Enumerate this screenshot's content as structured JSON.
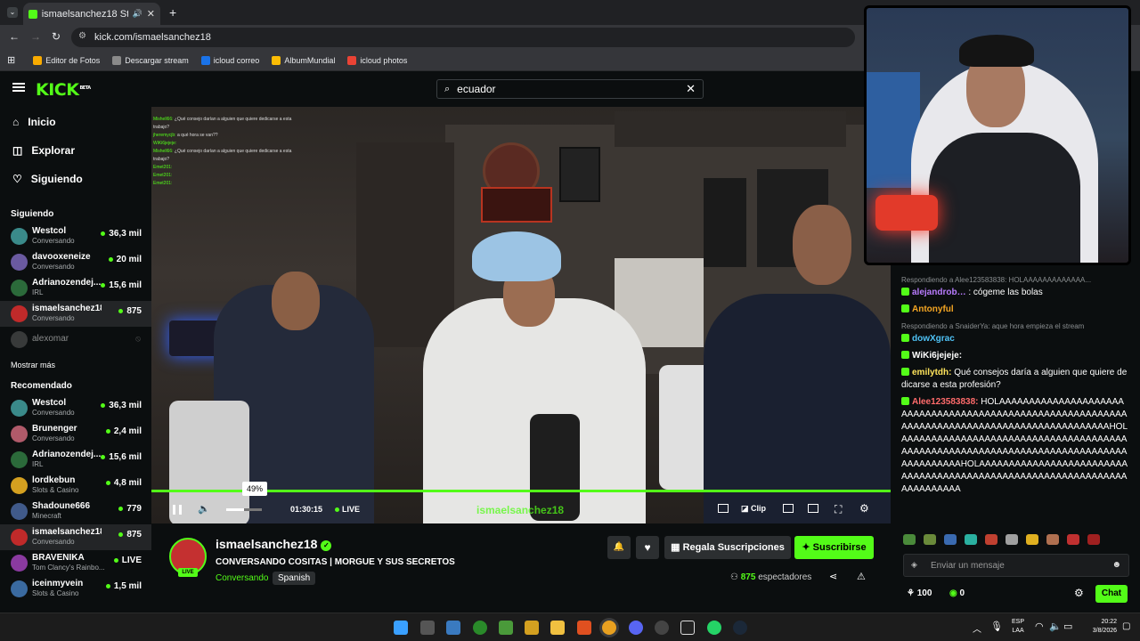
{
  "browser": {
    "tab_title": "ismaelsanchez18 Stream - …",
    "url": "kick.com/ismaelsanchez18",
    "bookmarks": [
      {
        "label": "Editor de Fotos",
        "color": "#f9ab00"
      },
      {
        "label": "Descargar stream",
        "color": "#8a8a8a"
      },
      {
        "label": "icloud correo",
        "color": "#1a73e8"
      },
      {
        "label": "AlbumMundial",
        "color": "#fbbc04"
      },
      {
        "label": "icloud photos",
        "color": "#ea4335"
      }
    ]
  },
  "header": {
    "logo": "KICK",
    "logo_badge": "BETA",
    "search_value": "ecuador"
  },
  "sidebar": {
    "nav": [
      {
        "label": "Inicio",
        "icon": "home-icon"
      },
      {
        "label": "Explorar",
        "icon": "compass-icon"
      },
      {
        "label": "Siguiendo",
        "icon": "heart-icon"
      }
    ],
    "following_title": "Siguiendo",
    "following": [
      {
        "name": "Westcol",
        "category": "Conversando",
        "viewers": "36,3 mil",
        "color": "#3a8a8a"
      },
      {
        "name": "davooxeneize",
        "category": "Conversando",
        "viewers": "20 mil",
        "color": "#6a5aa0"
      },
      {
        "name": "Adrianozendej...",
        "category": "IRL",
        "viewers": "15,6 mil",
        "color": "#2b6a3a"
      },
      {
        "name": "ismaelsanchez18",
        "category": "Conversando",
        "viewers": "875",
        "color": "#c02a2a"
      }
    ],
    "offline": {
      "name": "alexomar"
    },
    "show_more": "Mostrar más",
    "recommended_title": "Recomendado",
    "recommended": [
      {
        "name": "Westcol",
        "category": "Conversando",
        "viewers": "36,3 mil",
        "color": "#3a8a8a"
      },
      {
        "name": "Brunenger",
        "category": "Conversando",
        "viewers": "2,4 mil",
        "color": "#b05a6a"
      },
      {
        "name": "Adrianozendej...",
        "category": "IRL",
        "viewers": "15,6 mil",
        "color": "#2b6a3a"
      },
      {
        "name": "lordkebun",
        "category": "Slots & Casino",
        "viewers": "4,8 mil",
        "color": "#d4a020"
      },
      {
        "name": "Shadoune666",
        "category": "Minecraft",
        "viewers": "779",
        "color": "#405a8a"
      },
      {
        "name": "ismaelsanchez18",
        "category": "Conversando",
        "viewers": "875",
        "color": "#c02a2a"
      },
      {
        "name": "BRAVENIKA",
        "category": "Tom Clancy's Rainbo...",
        "viewers": "LIVE",
        "color": "#8a3aa0"
      },
      {
        "name": "iceinmyvein",
        "category": "Slots & Casino",
        "viewers": "1,5 mil",
        "color": "#3a6aa0"
      }
    ]
  },
  "player": {
    "seek_tooltip": "49%",
    "time": "01:30:15",
    "live": "LIVE",
    "clip": "Clip",
    "progress": 0.49,
    "overlay_chat": [
      {
        "user": "Mishell66:",
        "text": "¿Qué consejo darían a alguien que quiere dedicarse a esta trabajo?"
      },
      {
        "user": "jheremycjb:",
        "text": "a qué hora se van??"
      },
      {
        "user": "WiKi6jejeje:",
        "text": ""
      },
      {
        "user": "Mishell66:",
        "text": "¿Qué consejo darían a alguien que quiere dedicarse a esta trabajo?"
      },
      {
        "user": "Emet201:",
        "text": ""
      },
      {
        "user": "Emet201:",
        "text": ""
      },
      {
        "user": "Emet201:",
        "text": ""
      }
    ]
  },
  "stream": {
    "channel": "ismaelsanchez18",
    "title": "CONVERSANDO COSITAS | MORGUE Y SUS SECRETOS",
    "category": "Conversando",
    "language": "Spanish",
    "live_badge": "LIVE",
    "viewers": "875",
    "viewers_label": "espectadores",
    "gift_label": "Regala Suscripciones",
    "subscribe_label": "Suscribirse"
  },
  "chat": {
    "messages": [
      {
        "reply": "Respondiendo a Alee123583838: HOLAAAAAAAAAAAAA...",
        "user": "alejandrob…",
        "color": "#b97cff",
        "text": ": cógeme las bolas"
      },
      {
        "user": "Antonyful",
        "color": "#f5a623",
        "text": ""
      },
      {
        "reply": "Respondiendo a SnaiderYa: aque hora empieza el stream",
        "user": "dowXgrac",
        "color": "#4fc3f7",
        "text": ""
      },
      {
        "user": "WiKi6jejeje:",
        "color": "#ffffff",
        "text": ""
      },
      {
        "user": "emilytdh:",
        "color": "#ffe45c",
        "text": "Qué consejos daría a alguien que quiere dedicarse a esta profesión?"
      },
      {
        "user": "Alee123583838:",
        "color": "#ff6b6b",
        "text": "HOLAAAAAAAAAAAAAAAAAAAAAAAAAAAAAAAAAAAAAAAAAAAAAAAAAAAAAAAAAAAAAAAAAAAAAAAAAAAAAAAAAAAAAAAAAAAAAAHOLAAAAAAAAAAAAAAAAAAAAAAAAAAAAAAAAAAAAAAAAAAAAAAAAAAAAAAAAAAAAAAAAAAAAAAAAAAAAAAAAAAAAAAHOLAAAAAAAAAAAAAAAAAAAAAAAAAAAAAAAAAAAAAAAAAAAAAAAAAAAAAAAAAAAAAAAAAAAAAAAAA"
      }
    ],
    "input_placeholder": "Enviar un mensaje",
    "points": "100",
    "kicks": "0",
    "chat_button": "Chat"
  },
  "taskbar": {
    "lang": "ESP",
    "lang2": "LAA",
    "time": "20:22",
    "date": "3/8/2026"
  }
}
